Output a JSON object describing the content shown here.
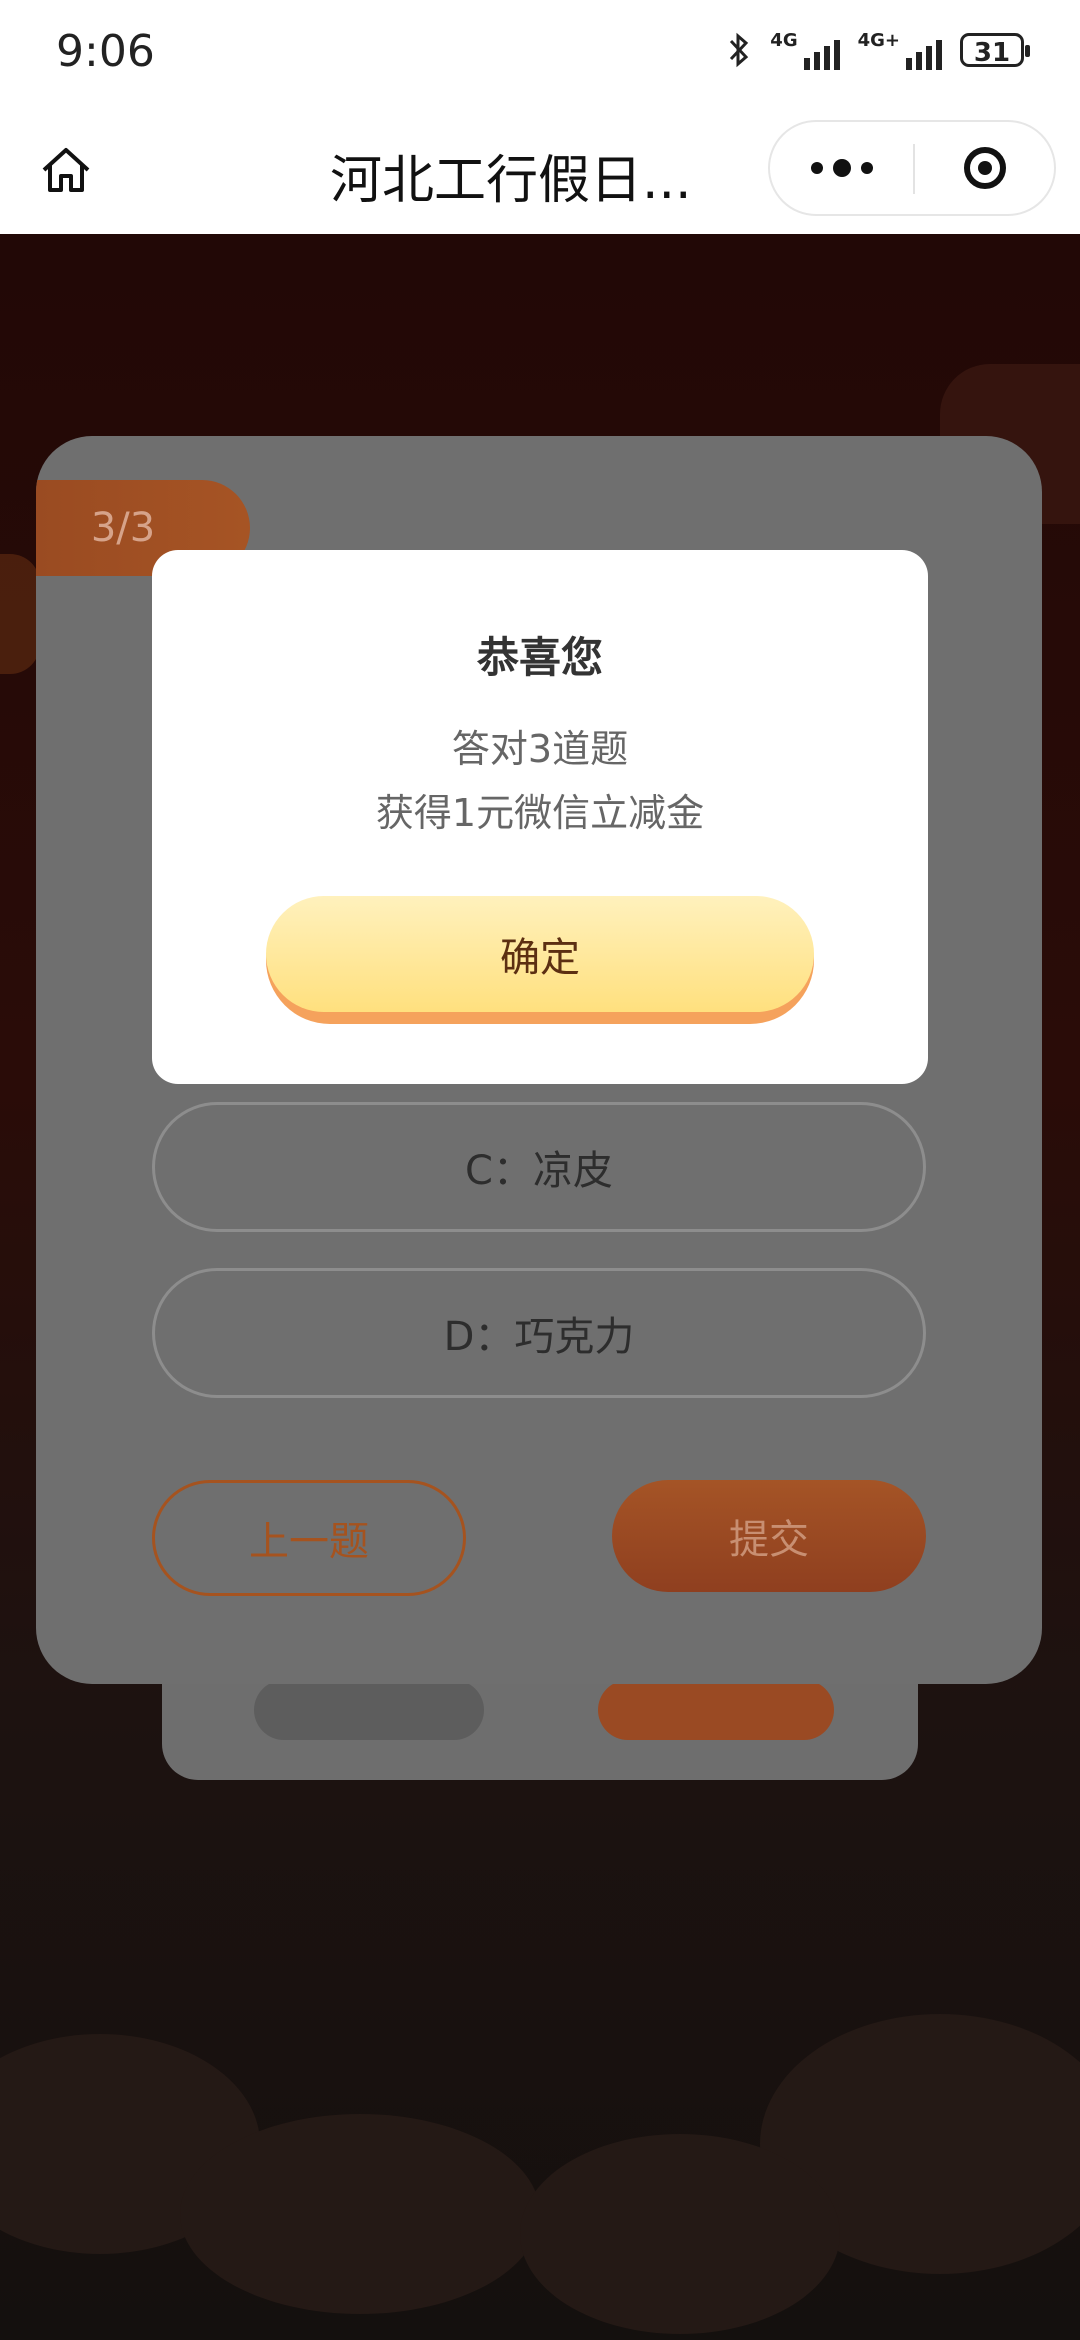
{
  "status_bar": {
    "time": "9:06",
    "network_1": "4G",
    "network_2": "4G+",
    "battery": "31"
  },
  "nav": {
    "title": "河北工行假日..."
  },
  "quiz": {
    "progress": "3/3",
    "options": [
      {
        "label": "C：凉皮"
      },
      {
        "label": "D：巧克力"
      }
    ],
    "prev_label": "上一题",
    "submit_label": "提交"
  },
  "modal": {
    "title": "恭喜您",
    "line1": "答对3道题",
    "line2": "获得1元微信立减金",
    "confirm_label": "确定"
  }
}
